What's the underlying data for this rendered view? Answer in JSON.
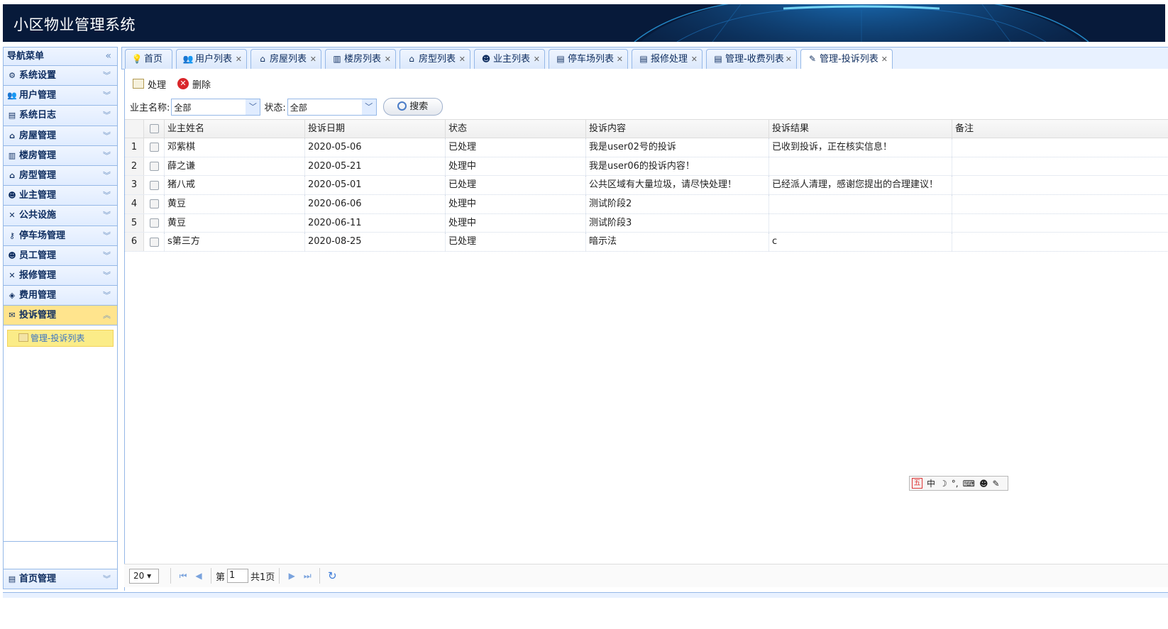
{
  "app": {
    "title": "小区物业管理系统"
  },
  "sidebar": {
    "header": "导航菜单",
    "collapse_icon": "double-chevron-left-icon",
    "items": [
      {
        "label": "系统设置",
        "icon": "gear-icon"
      },
      {
        "label": "用户管理",
        "icon": "users-icon"
      },
      {
        "label": "系统日志",
        "icon": "log-icon"
      },
      {
        "label": "房屋管理",
        "icon": "house-icon"
      },
      {
        "label": "楼房管理",
        "icon": "building-icon"
      },
      {
        "label": "房型管理",
        "icon": "house-type-icon"
      },
      {
        "label": "业主管理",
        "icon": "owner-icon"
      },
      {
        "label": "公共设施",
        "icon": "tools-icon"
      },
      {
        "label": "停车场管理",
        "icon": "key-icon"
      },
      {
        "label": "员工管理",
        "icon": "staff-icon"
      },
      {
        "label": "报修管理",
        "icon": "repair-icon"
      },
      {
        "label": "费用管理",
        "icon": "money-icon"
      },
      {
        "label": "投诉管理",
        "icon": "complaint-icon"
      }
    ],
    "active_sub": "管理-投诉列表",
    "bottom_item": "首页管理"
  },
  "tabs": [
    {
      "label": "首页",
      "icon": "bulb-icon",
      "closable": false
    },
    {
      "label": "用户列表",
      "icon": "users-icon",
      "closable": true
    },
    {
      "label": "房屋列表",
      "icon": "house-icon",
      "closable": true
    },
    {
      "label": "楼房列表",
      "icon": "building-icon",
      "closable": true
    },
    {
      "label": "房型列表",
      "icon": "house-type-icon",
      "closable": true
    },
    {
      "label": "业主列表",
      "icon": "owner-icon",
      "closable": true
    },
    {
      "label": "停车场列表",
      "icon": "table-icon",
      "closable": true
    },
    {
      "label": "报修处理",
      "icon": "table-icon",
      "closable": true
    },
    {
      "label": "管理-收费列表",
      "icon": "table-icon",
      "closable": true
    },
    {
      "label": "管理-投诉列表",
      "icon": "note-icon",
      "closable": true,
      "active": true
    }
  ],
  "toolbar": {
    "process_label": "处理",
    "delete_label": "删除"
  },
  "search": {
    "owner_label": "业主名称:",
    "owner_value": "全部",
    "status_label": "状态:",
    "status_value": "全部",
    "button_label": "搜索"
  },
  "grid": {
    "columns": [
      "业主姓名",
      "投诉日期",
      "状态",
      "投诉内容",
      "投诉结果",
      "备注"
    ],
    "rows": [
      {
        "num": "1",
        "name": "邓紫棋",
        "date": "2020-05-06",
        "status": "已处理",
        "content": "我是user02号的投诉",
        "result": "已收到投诉，正在核实信息！",
        "note": ""
      },
      {
        "num": "2",
        "name": "薛之谦",
        "date": "2020-05-21",
        "status": "处理中",
        "content": "我是user06的投诉内容！",
        "result": "",
        "note": ""
      },
      {
        "num": "3",
        "name": "猪八戒",
        "date": "2020-05-01",
        "status": "已处理",
        "content": "公共区域有大量垃圾，请尽快处理！",
        "result": "已经派人清理，感谢您提出的合理建议！",
        "note": ""
      },
      {
        "num": "4",
        "name": "黄豆",
        "date": "2020-06-06",
        "status": "处理中",
        "content": "测试阶段2",
        "result": "",
        "note": ""
      },
      {
        "num": "5",
        "name": "黄豆",
        "date": "2020-06-11",
        "status": "处理中",
        "content": "测试阶段3",
        "result": "",
        "note": ""
      },
      {
        "num": "6",
        "name": "s第三方",
        "date": "2020-08-25",
        "status": "已处理",
        "content": "暗示法",
        "result": "c",
        "note": ""
      }
    ]
  },
  "pager": {
    "page_size": "20",
    "page_prefix": "第",
    "page_value": "1",
    "total_pages": "共1页"
  },
  "ime": {
    "mode": "中",
    "badge": "五"
  },
  "colors": {
    "header_bg": "#071a3a",
    "accent_border": "#95b8e7",
    "active_item": "#ffe48d"
  }
}
